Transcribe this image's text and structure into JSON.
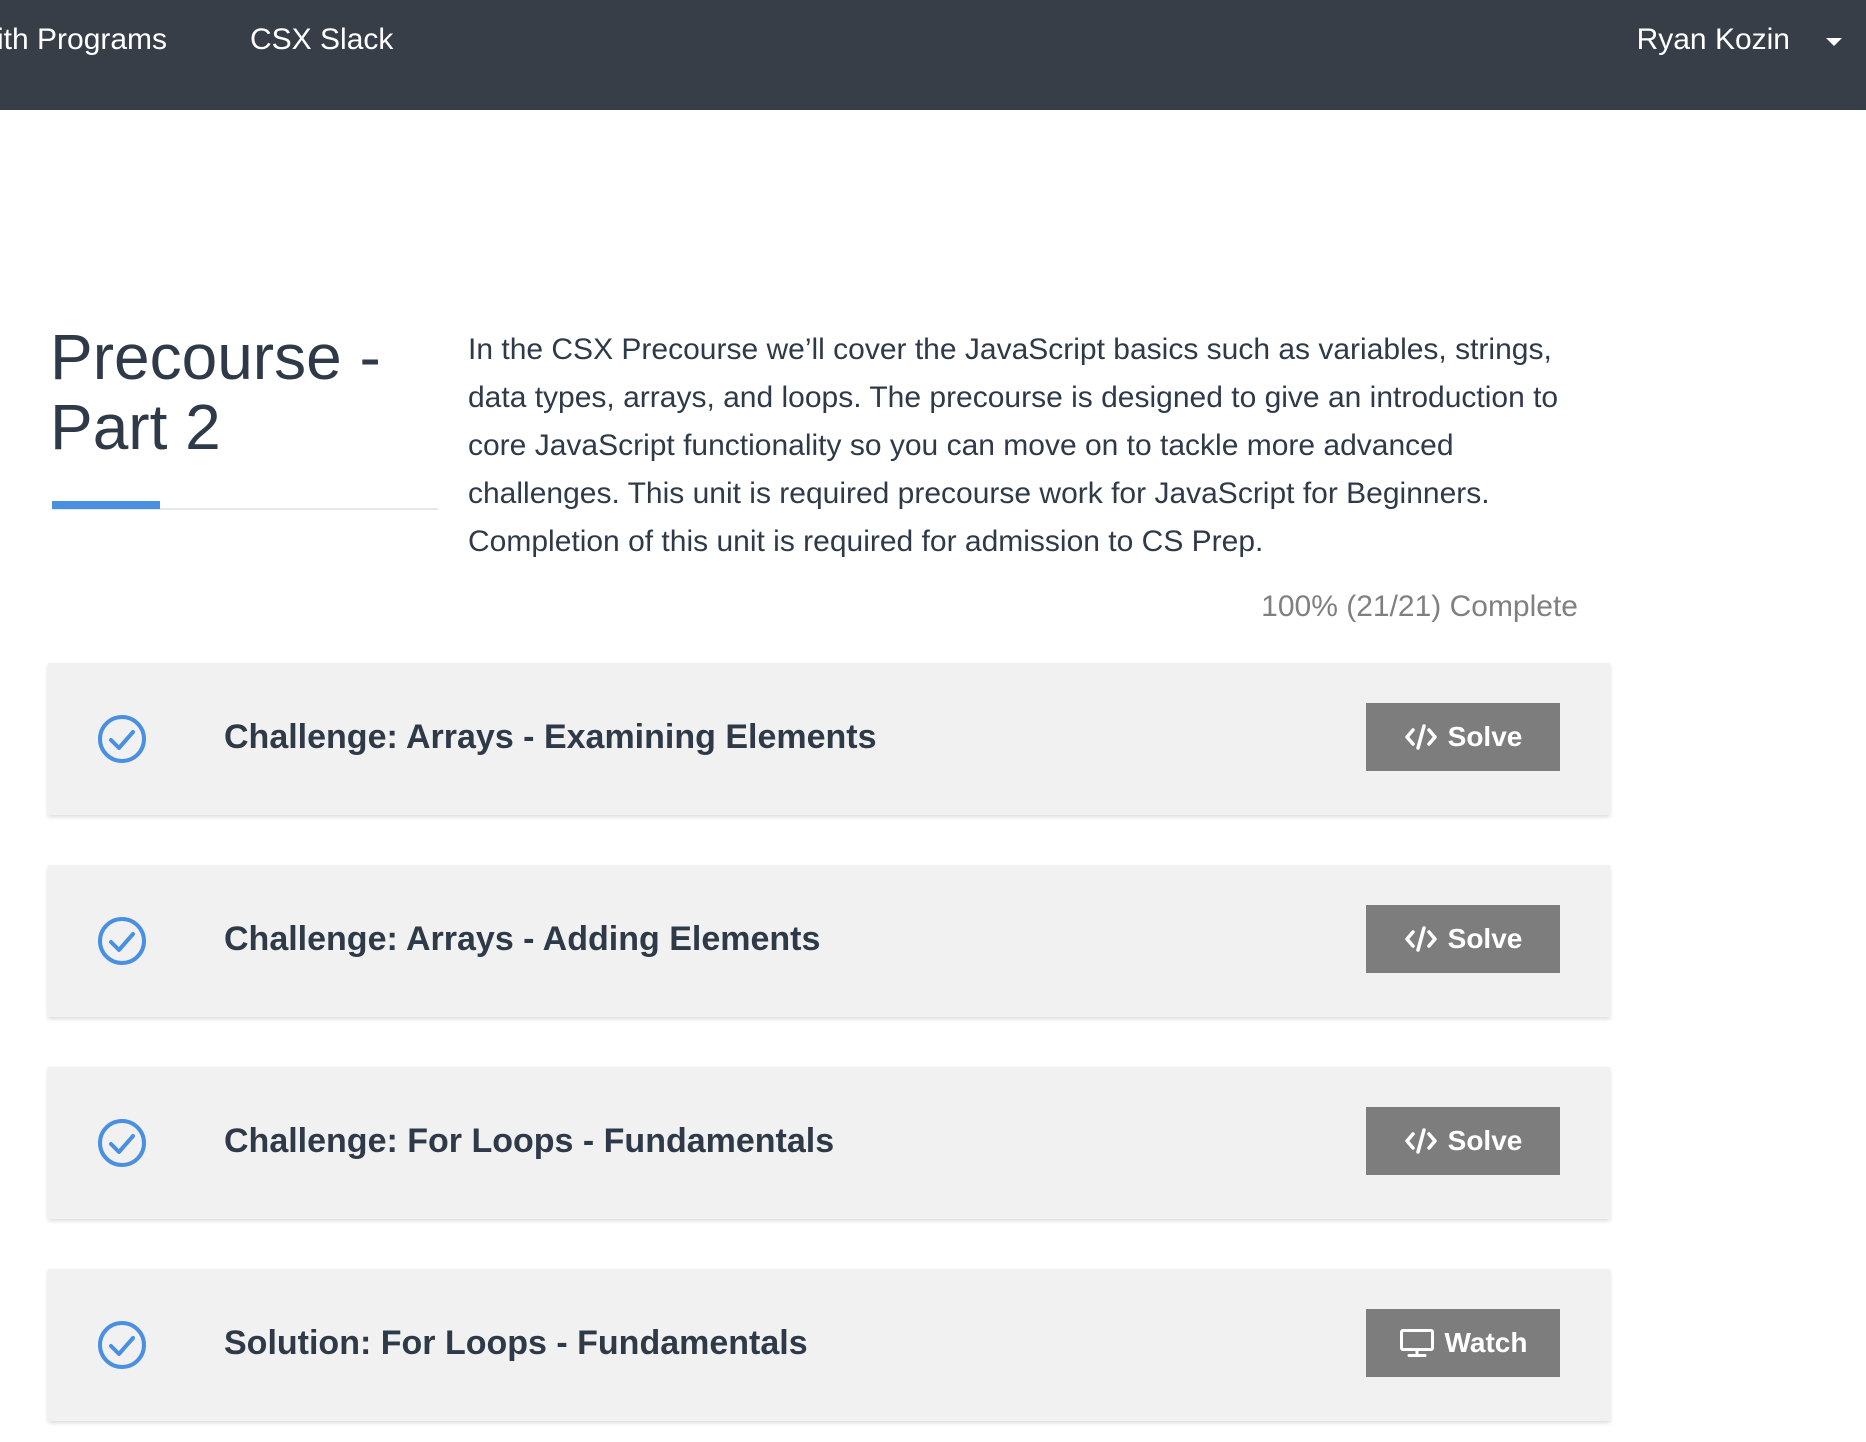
{
  "nav": {
    "programs_label": "mith Programs",
    "slack_label": "CSX Slack",
    "user_name": "Ryan Kozin"
  },
  "unit": {
    "title": "Precourse - Part 2",
    "description": "In the CSX Precourse we’ll cover the JavaScript basics such as variables, strings, data types, arrays, and loops. The precourse is designed to give an introduction to core JavaScript functionality so you can move on to tackle more advanced challenges. This unit is required precourse work for JavaScript for Beginners. Completion of this unit is required for admission to CS Prep.",
    "progress_label": "100% (21/21) Complete",
    "progress_fraction": 1.0
  },
  "items": [
    {
      "title": "Challenge: Arrays - Examining Elements",
      "button_label": "Solve",
      "button_icon": "code-icon",
      "completed": true
    },
    {
      "title": "Challenge: Arrays - Adding Elements",
      "button_label": "Solve",
      "button_icon": "code-icon",
      "completed": true
    },
    {
      "title": "Challenge: For Loops - Fundamentals",
      "button_label": "Solve",
      "button_icon": "code-icon",
      "completed": true
    },
    {
      "title": "Solution: For Loops - Fundamentals",
      "button_label": "Watch",
      "button_icon": "monitor-icon",
      "completed": true
    }
  ],
  "colors": {
    "nav_bg": "#373e48",
    "accent": "#4a90e2",
    "card_bg": "#f1f1f1",
    "button_bg": "#7d7d7d",
    "text": "#2f3a49"
  }
}
